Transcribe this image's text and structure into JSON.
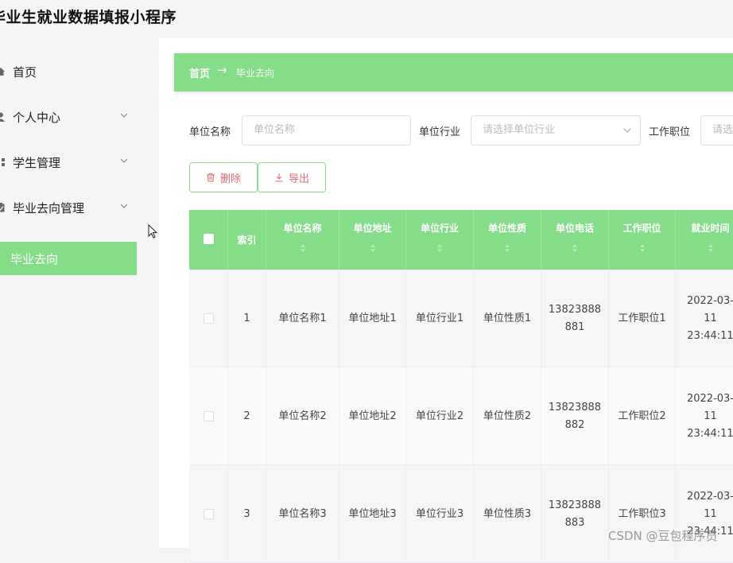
{
  "app": {
    "title": "毕业生就业数据填报小程序"
  },
  "sidebar": {
    "items": [
      {
        "label": "首页",
        "icon": "home-icon",
        "has_submenu": false
      },
      {
        "label": "个人中心",
        "icon": "user-icon",
        "has_submenu": true
      },
      {
        "label": "学生管理",
        "icon": "grid-icon",
        "has_submenu": true
      },
      {
        "label": "毕业去向管理",
        "icon": "clipboard-icon",
        "has_submenu": true
      }
    ],
    "active_subitem": "毕业去向"
  },
  "breadcrumb": {
    "home": "首页",
    "separator": "→",
    "current": "毕业去向"
  },
  "filters": {
    "unit_name_label": "单位名称",
    "unit_name_placeholder": "单位名称",
    "industry_label": "单位行业",
    "industry_placeholder": "请选择单位行业",
    "position_label": "工作职位",
    "position_placeholder": "请选择"
  },
  "toolbar": {
    "delete_label": "删除",
    "export_label": "导出"
  },
  "table": {
    "columns": [
      "索引",
      "单位名称",
      "单位地址",
      "单位行业",
      "单位性质",
      "单位电话",
      "工作职位",
      "就业时间"
    ],
    "rows": [
      {
        "index": "1",
        "name": "单位名称1",
        "address": "单位地址1",
        "industry": "单位行业1",
        "nature": "单位性质1",
        "phone": "13823888881",
        "position": "工作职位1",
        "time": "2022-03-11 23:44:11"
      },
      {
        "index": "2",
        "name": "单位名称2",
        "address": "单位地址2",
        "industry": "单位行业2",
        "nature": "单位性质2",
        "phone": "13823888882",
        "position": "工作职位2",
        "time": "2022-03-11 23:44:11"
      },
      {
        "index": "3",
        "name": "单位名称3",
        "address": "单位地址3",
        "industry": "单位行业3",
        "nature": "单位性质3",
        "phone": "13823888883",
        "position": "工作职位3",
        "time": "2022-03-11 23:44:11"
      }
    ]
  },
  "watermark": "CSDN @豆包程序员",
  "colors": {
    "accent": "#85dd8a",
    "danger": "#e26b6b"
  }
}
